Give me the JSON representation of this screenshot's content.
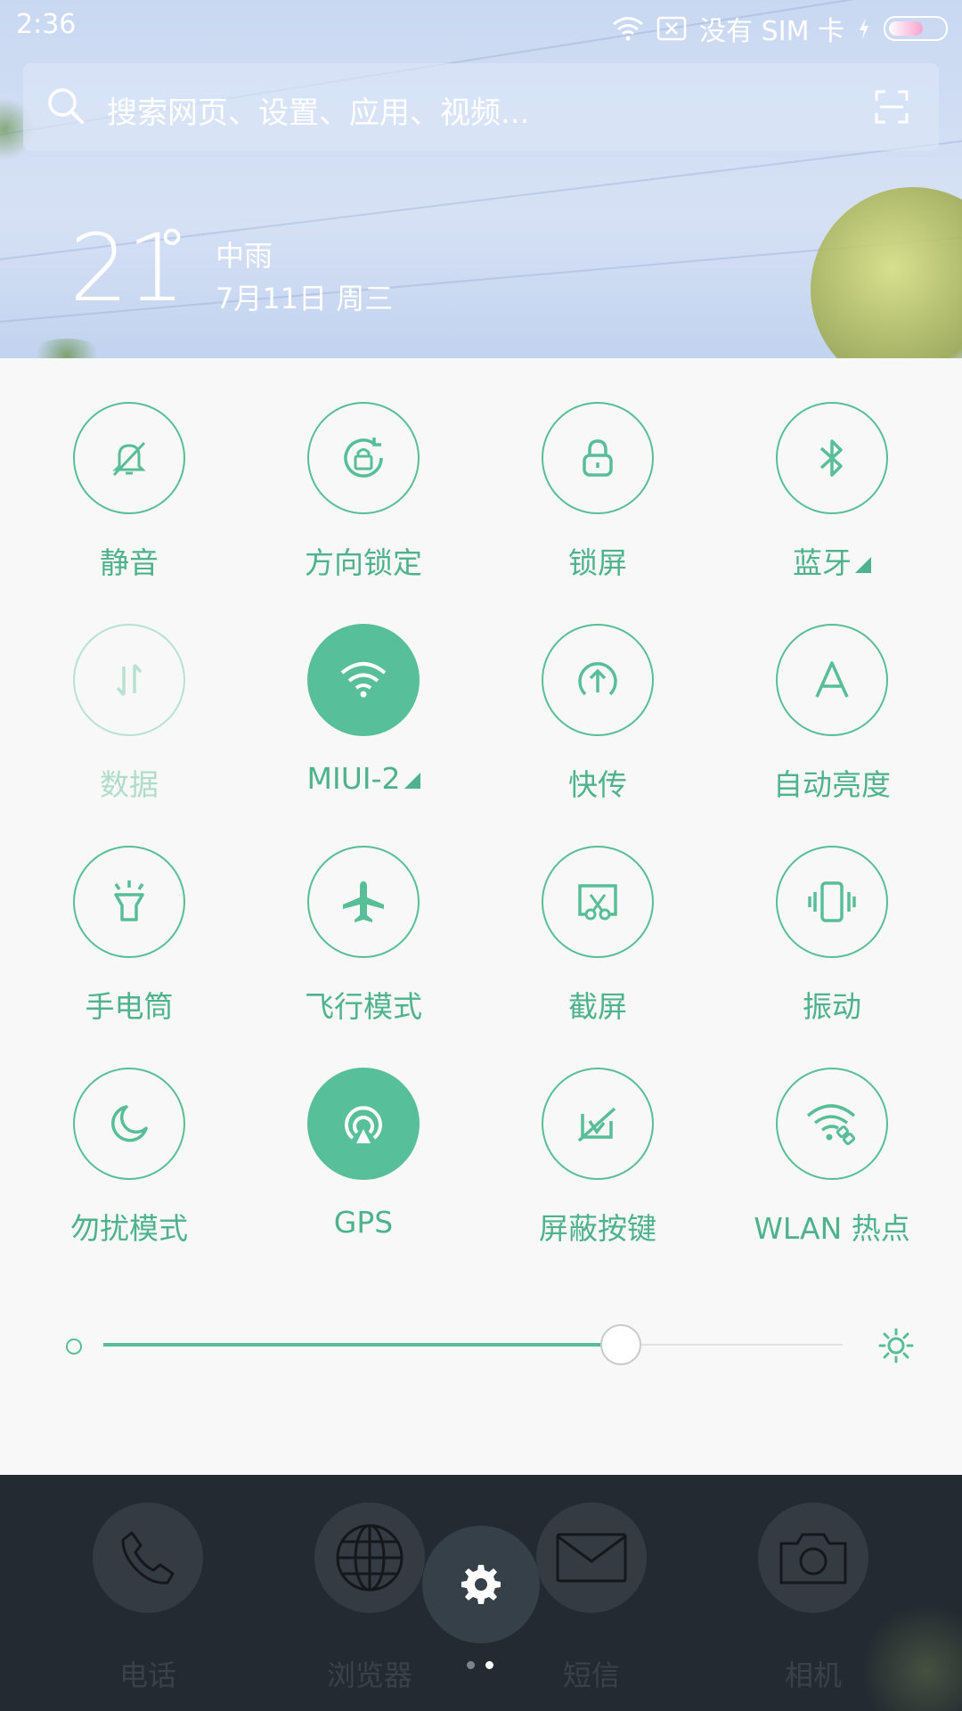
{
  "status_bar": {
    "time": "2:36",
    "carrier": "没有 SIM 卡"
  },
  "search": {
    "placeholder": "搜索网页、设置、应用、视频..."
  },
  "weather": {
    "temperature": "21",
    "degree_symbol": "°",
    "condition": "中雨",
    "date": "7月11日 周三"
  },
  "toggles": [
    {
      "label": "静音",
      "icon": "bell-off-icon",
      "state": "off"
    },
    {
      "label": "方向锁定",
      "icon": "rotation-lock-icon",
      "state": "off"
    },
    {
      "label": "锁屏",
      "icon": "lock-icon",
      "state": "off"
    },
    {
      "label": "蓝牙",
      "icon": "bluetooth-icon",
      "state": "off",
      "has_menu": true
    },
    {
      "label": "数据",
      "icon": "data-arrows-icon",
      "state": "disabled"
    },
    {
      "label": "MIUI-2",
      "icon": "wifi-icon",
      "state": "on",
      "has_menu": true
    },
    {
      "label": "快传",
      "icon": "upload-icon",
      "state": "off"
    },
    {
      "label": "自动亮度",
      "icon": "auto-brightness-icon",
      "state": "off"
    },
    {
      "label": "手电筒",
      "icon": "flashlight-icon",
      "state": "off"
    },
    {
      "label": "飞行模式",
      "icon": "airplane-icon",
      "state": "off"
    },
    {
      "label": "截屏",
      "icon": "screenshot-icon",
      "state": "off"
    },
    {
      "label": "振动",
      "icon": "vibrate-icon",
      "state": "off"
    },
    {
      "label": "勿扰模式",
      "icon": "moon-icon",
      "state": "off"
    },
    {
      "label": "GPS",
      "icon": "gps-icon",
      "state": "on"
    },
    {
      "label": "屏蔽按键",
      "icon": "block-keys-icon",
      "state": "off"
    },
    {
      "label": "WLAN 热点",
      "icon": "hotspot-icon",
      "state": "off"
    }
  ],
  "brightness": {
    "level": 0.7
  },
  "dock": [
    {
      "label": "电话",
      "icon": "phone-icon"
    },
    {
      "label": "浏览器",
      "icon": "globe-icon"
    },
    {
      "label": "短信",
      "icon": "envelope-icon"
    },
    {
      "label": "相机",
      "icon": "camera-icon"
    }
  ],
  "colors": {
    "accent": "#57bf9a",
    "panel": "#f7f8f7",
    "dock": "#242a31"
  }
}
